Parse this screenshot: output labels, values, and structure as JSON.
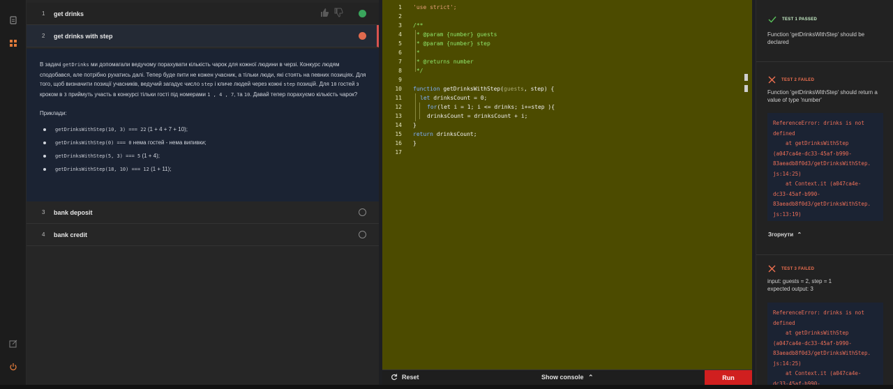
{
  "rail": {
    "icons": [
      "document-icon",
      "grid-icon",
      "external-link-icon",
      "power-icon"
    ]
  },
  "tasks": [
    {
      "num": "1",
      "title": "get drinks",
      "status": "done"
    },
    {
      "num": "2",
      "title": "get drinks with step",
      "status": "failed"
    },
    {
      "num": "3",
      "title": "bank deposit",
      "status": "empty"
    },
    {
      "num": "4",
      "title": "bank credit",
      "status": "empty"
    }
  ],
  "description": {
    "p1_a": "В задачі ",
    "p1_code1": "getDrinks",
    "p1_b": " ми допомагали ведучому порахувати кількість чарок для кожної людини в черзі. Конкурс людям сподобався, але потрібно рухатись далі. Тепер буде пити не кожен учасник, а тільки люди, які стоять на певних позиціях. Для того, щоб визначити позиції учасників, ведучий загадує число ",
    "p1_code2": "step",
    "p1_c": " і кличе людей через кожні ",
    "p1_code3": "step",
    "p1_d": " позицій. Для ",
    "p1_code4": "10",
    "p1_e": " гостей з кроком в ",
    "p1_code5": "3",
    "p1_f": " приймуть участь в конкурсі тільки гості під номерами ",
    "p1_code6": "1 , 4 , 7",
    "p1_g": ", та ",
    "p1_code7": "10",
    "p1_h": ". Давай тепер порахуємо кількість чарок?",
    "examples_title": "Приклади:",
    "examples": [
      {
        "code": "getDrinksWithStep(10, 3) === 22",
        "text": " (1 + 4 + 7 + 10);"
      },
      {
        "code": "getDrinksWithStep(0) === 0",
        "text": " нема гостей - нема випивки;"
      },
      {
        "code": "getDrinksWithStep(5, 3) === 5",
        "text": " (1 + 4);"
      },
      {
        "code": "getDrinksWithStep(18, 10) === 12",
        "text": " (1 + 11);"
      }
    ]
  },
  "editor": {
    "line_numbers": [
      "1",
      "2",
      "3",
      "4",
      "5",
      "6",
      "7",
      "8",
      "9",
      "10",
      "11",
      "12",
      "13",
      "14",
      "15",
      "16",
      "17"
    ],
    "lines": {
      "l1": "'use strict';",
      "l3": "/**",
      "l4": " * @param {number} guests",
      "l5": " * @param {number} step",
      "l6": " *",
      "l7": " * @returns number",
      "l8": " */",
      "l10_kw": "function",
      "l10_a": " getDrinksWithStep(",
      "l10_param": "guests",
      "l10_b": ", step) {",
      "l11_kw": "let",
      "l11_a": " drinksCount = 0;",
      "l12_kw": "for",
      "l12_a": "(let i = 1; i <= drinks; i+=step ){",
      "l13": "drinksCount = drinksCount + i;",
      "l14": "}",
      "l15_kw": "return",
      "l15_a": " drinksCount;",
      "l16": "}"
    },
    "reset_label": "Reset",
    "console_label": "Show console",
    "run_label": "Run"
  },
  "results": {
    "t1_head": "TEST 1 PASSED",
    "t1_text": "Function 'getDrinksWithStep' should be declared",
    "t2_head": "TEST 2 FAILED",
    "t2_text": "Function 'getDrinksWithStep' should return a value of type 'number'",
    "t2_error": "ReferenceError: drinks is not\ndefined\n    at getDrinksWithStep\n(a047ca4e-dc33-45af-b990-\n83aeadb8f0d3/getDrinksWithStep.\njs:14:25)\n    at Context.it (a047ca4e-\ndc33-45af-b990-\n83aeadb8f0d3/getDrinksWithStep.\njs:13:19)",
    "collapse_label": "Згорнути",
    "t3_head": "TEST 3 FAILED",
    "t3_text": "input: guests = 2, step = 1\nexpected output: 3",
    "t3_error": "ReferenceError: drinks is not\ndefined\n    at getDrinksWithStep\n(a047ca4e-dc33-45af-b990-\n83aeadb8f0d3/getDrinksWithStep.\njs:14:25)\n    at Context.it (a047ca4e-\ndc33-45af-b990-"
  }
}
